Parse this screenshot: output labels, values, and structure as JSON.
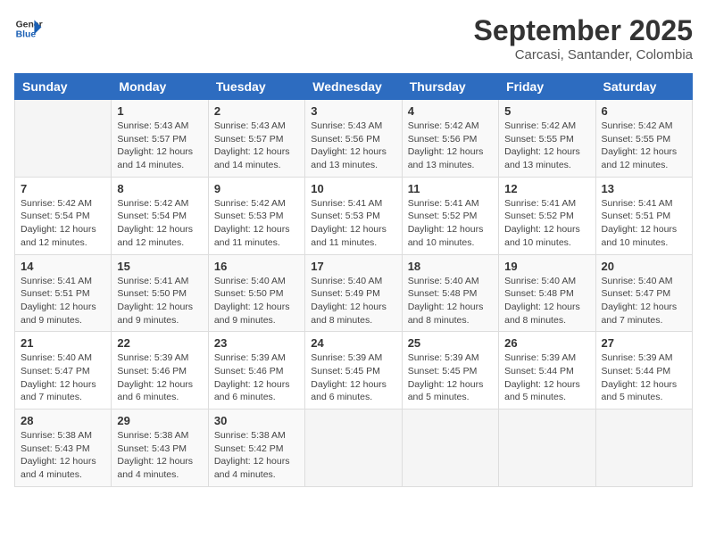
{
  "logo": {
    "line1": "General",
    "line2": "Blue"
  },
  "title": "September 2025",
  "subtitle": "Carcasi, Santander, Colombia",
  "weekdays": [
    "Sunday",
    "Monday",
    "Tuesday",
    "Wednesday",
    "Thursday",
    "Friday",
    "Saturday"
  ],
  "weeks": [
    [
      {
        "day": "",
        "info": ""
      },
      {
        "day": "1",
        "info": "Sunrise: 5:43 AM\nSunset: 5:57 PM\nDaylight: 12 hours\nand 14 minutes."
      },
      {
        "day": "2",
        "info": "Sunrise: 5:43 AM\nSunset: 5:57 PM\nDaylight: 12 hours\nand 14 minutes."
      },
      {
        "day": "3",
        "info": "Sunrise: 5:43 AM\nSunset: 5:56 PM\nDaylight: 12 hours\nand 13 minutes."
      },
      {
        "day": "4",
        "info": "Sunrise: 5:42 AM\nSunset: 5:56 PM\nDaylight: 12 hours\nand 13 minutes."
      },
      {
        "day": "5",
        "info": "Sunrise: 5:42 AM\nSunset: 5:55 PM\nDaylight: 12 hours\nand 13 minutes."
      },
      {
        "day": "6",
        "info": "Sunrise: 5:42 AM\nSunset: 5:55 PM\nDaylight: 12 hours\nand 12 minutes."
      }
    ],
    [
      {
        "day": "7",
        "info": "Sunrise: 5:42 AM\nSunset: 5:54 PM\nDaylight: 12 hours\nand 12 minutes."
      },
      {
        "day": "8",
        "info": "Sunrise: 5:42 AM\nSunset: 5:54 PM\nDaylight: 12 hours\nand 12 minutes."
      },
      {
        "day": "9",
        "info": "Sunrise: 5:42 AM\nSunset: 5:53 PM\nDaylight: 12 hours\nand 11 minutes."
      },
      {
        "day": "10",
        "info": "Sunrise: 5:41 AM\nSunset: 5:53 PM\nDaylight: 12 hours\nand 11 minutes."
      },
      {
        "day": "11",
        "info": "Sunrise: 5:41 AM\nSunset: 5:52 PM\nDaylight: 12 hours\nand 10 minutes."
      },
      {
        "day": "12",
        "info": "Sunrise: 5:41 AM\nSunset: 5:52 PM\nDaylight: 12 hours\nand 10 minutes."
      },
      {
        "day": "13",
        "info": "Sunrise: 5:41 AM\nSunset: 5:51 PM\nDaylight: 12 hours\nand 10 minutes."
      }
    ],
    [
      {
        "day": "14",
        "info": "Sunrise: 5:41 AM\nSunset: 5:51 PM\nDaylight: 12 hours\nand 9 minutes."
      },
      {
        "day": "15",
        "info": "Sunrise: 5:41 AM\nSunset: 5:50 PM\nDaylight: 12 hours\nand 9 minutes."
      },
      {
        "day": "16",
        "info": "Sunrise: 5:40 AM\nSunset: 5:50 PM\nDaylight: 12 hours\nand 9 minutes."
      },
      {
        "day": "17",
        "info": "Sunrise: 5:40 AM\nSunset: 5:49 PM\nDaylight: 12 hours\nand 8 minutes."
      },
      {
        "day": "18",
        "info": "Sunrise: 5:40 AM\nSunset: 5:48 PM\nDaylight: 12 hours\nand 8 minutes."
      },
      {
        "day": "19",
        "info": "Sunrise: 5:40 AM\nSunset: 5:48 PM\nDaylight: 12 hours\nand 8 minutes."
      },
      {
        "day": "20",
        "info": "Sunrise: 5:40 AM\nSunset: 5:47 PM\nDaylight: 12 hours\nand 7 minutes."
      }
    ],
    [
      {
        "day": "21",
        "info": "Sunrise: 5:40 AM\nSunset: 5:47 PM\nDaylight: 12 hours\nand 7 minutes."
      },
      {
        "day": "22",
        "info": "Sunrise: 5:39 AM\nSunset: 5:46 PM\nDaylight: 12 hours\nand 6 minutes."
      },
      {
        "day": "23",
        "info": "Sunrise: 5:39 AM\nSunset: 5:46 PM\nDaylight: 12 hours\nand 6 minutes."
      },
      {
        "day": "24",
        "info": "Sunrise: 5:39 AM\nSunset: 5:45 PM\nDaylight: 12 hours\nand 6 minutes."
      },
      {
        "day": "25",
        "info": "Sunrise: 5:39 AM\nSunset: 5:45 PM\nDaylight: 12 hours\nand 5 minutes."
      },
      {
        "day": "26",
        "info": "Sunrise: 5:39 AM\nSunset: 5:44 PM\nDaylight: 12 hours\nand 5 minutes."
      },
      {
        "day": "27",
        "info": "Sunrise: 5:39 AM\nSunset: 5:44 PM\nDaylight: 12 hours\nand 5 minutes."
      }
    ],
    [
      {
        "day": "28",
        "info": "Sunrise: 5:38 AM\nSunset: 5:43 PM\nDaylight: 12 hours\nand 4 minutes."
      },
      {
        "day": "29",
        "info": "Sunrise: 5:38 AM\nSunset: 5:43 PM\nDaylight: 12 hours\nand 4 minutes."
      },
      {
        "day": "30",
        "info": "Sunrise: 5:38 AM\nSunset: 5:42 PM\nDaylight: 12 hours\nand 4 minutes."
      },
      {
        "day": "",
        "info": ""
      },
      {
        "day": "",
        "info": ""
      },
      {
        "day": "",
        "info": ""
      },
      {
        "day": "",
        "info": ""
      }
    ]
  ]
}
